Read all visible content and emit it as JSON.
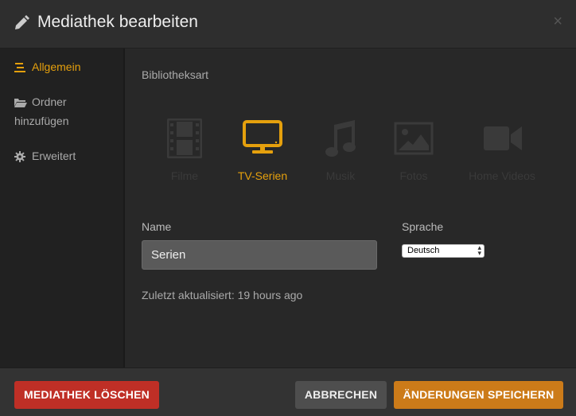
{
  "header": {
    "title": "Mediathek bearbeiten",
    "close": "×"
  },
  "sidebar": {
    "items": [
      {
        "label": "Allgemein",
        "icon": "list-icon",
        "active": true
      },
      {
        "label": "Ordner hinzufügen",
        "icon": "folder-icon",
        "active": false
      },
      {
        "label": "Erweitert",
        "icon": "gear-icon",
        "active": false
      }
    ]
  },
  "main": {
    "library_type_label": "Bibliotheksart",
    "types": [
      {
        "label": "Filme",
        "icon": "film-icon",
        "selected": false
      },
      {
        "label": "TV-Serien",
        "icon": "tv-icon",
        "selected": true
      },
      {
        "label": "Musik",
        "icon": "music-icon",
        "selected": false
      },
      {
        "label": "Fotos",
        "icon": "photo-icon",
        "selected": false
      },
      {
        "label": "Home Videos",
        "icon": "video-camera-icon",
        "selected": false
      }
    ],
    "name_label": "Name",
    "name_value": "Serien",
    "language_label": "Sprache",
    "language_value": "Deutsch",
    "updated_text": "Zuletzt aktualisiert: 19 hours ago"
  },
  "footer": {
    "delete_label": "MEDIATHEK LÖSCHEN",
    "cancel_label": "ABBRECHEN",
    "save_label": "ÄNDERUNGEN SPEICHERN"
  },
  "colors": {
    "accent": "#e5a00d",
    "delete": "#bf2f26",
    "save": "#cc7b19",
    "cancel": "#4e4e4e"
  }
}
